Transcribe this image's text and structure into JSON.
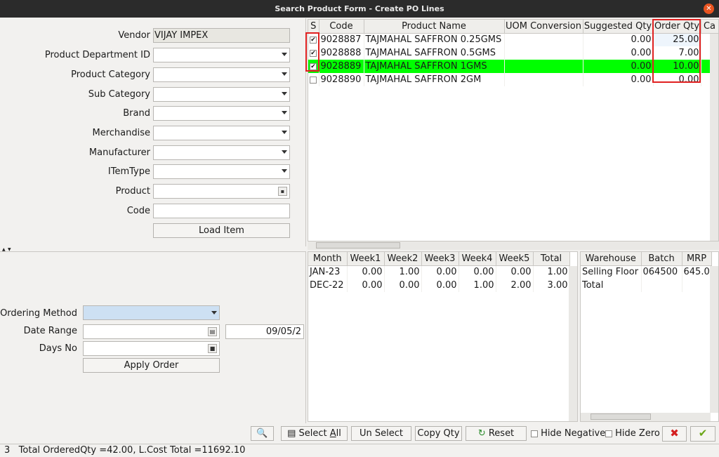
{
  "window": {
    "title": "Search Product Form - Create PO Lines"
  },
  "filters": {
    "vendor": {
      "label": "Vendor",
      "value": "VIJAY IMPEX"
    },
    "product_department_id": {
      "label": "Product Department ID"
    },
    "product_category": {
      "label": "Product Category"
    },
    "sub_category": {
      "label": "Sub Category"
    },
    "brand": {
      "label": "Brand"
    },
    "merchandise": {
      "label": "Merchandise"
    },
    "manufacturer": {
      "label": "Manufacturer"
    },
    "item_type": {
      "label": "ITemType"
    },
    "product": {
      "label": "Product"
    },
    "code": {
      "label": "Code"
    },
    "load_item_label": "Load Item"
  },
  "ordering": {
    "ordering_method_label": "Ordering Method",
    "date_range_label": "Date Range",
    "date_range_to": "09/05/2",
    "days_no_label": "Days No",
    "apply_order_label": "Apply Order"
  },
  "product_grid": {
    "columns": [
      "S",
      "Code",
      "Product Name",
      "UOM Conversion",
      "Suggested Qty",
      "Order Qty",
      "Ca"
    ],
    "rows": [
      {
        "checked": true,
        "code": "9028887",
        "name": "TAJMAHAL SAFFRON 0.25GMS",
        "uom": "",
        "suggested": "0.00",
        "order": "25.00"
      },
      {
        "checked": true,
        "code": "9028888",
        "name": "TAJMAHAL SAFFRON 0.5GMS",
        "uom": "",
        "suggested": "0.00",
        "order": "7.00"
      },
      {
        "checked": true,
        "code": "9028889",
        "name": "TAJMAHAL SAFFRON 1GMS",
        "uom": "",
        "suggested": "0.00",
        "order": "10.00"
      },
      {
        "checked": false,
        "code": "9028890",
        "name": "TAJMAHAL SAFFRON 2GM",
        "uom": "",
        "suggested": "0.00",
        "order": "0.00"
      }
    ],
    "selected_color": "#00ff00"
  },
  "sales_grid": {
    "columns": [
      "Month",
      "Week1",
      "Week2",
      "Week3",
      "Week4",
      "Week5",
      "Total"
    ],
    "rows": [
      [
        "JAN-23",
        "0.00",
        "1.00",
        "0.00",
        "0.00",
        "0.00",
        "1.00"
      ],
      [
        "DEC-22",
        "0.00",
        "0.00",
        "0.00",
        "1.00",
        "2.00",
        "3.00"
      ]
    ]
  },
  "stock_grid": {
    "columns": [
      "Warehouse",
      "Batch",
      "MRP"
    ],
    "rows": [
      [
        "Selling Floor",
        "064500",
        "645.0"
      ],
      [
        "Total",
        "",
        ""
      ]
    ]
  },
  "toolbar": {
    "select_all": "Select All",
    "un_select": "Un Select",
    "copy_qty": "Copy Qty",
    "reset": "Reset",
    "hide_negative": "Hide Negative",
    "hide_zero": "Hide Zero"
  },
  "status": {
    "text": "3   Total OrderedQty =42.00, L.Cost Total =11692.10"
  },
  "colors": {
    "accent_close": "#e95420",
    "highlight_box": "#e02020"
  }
}
